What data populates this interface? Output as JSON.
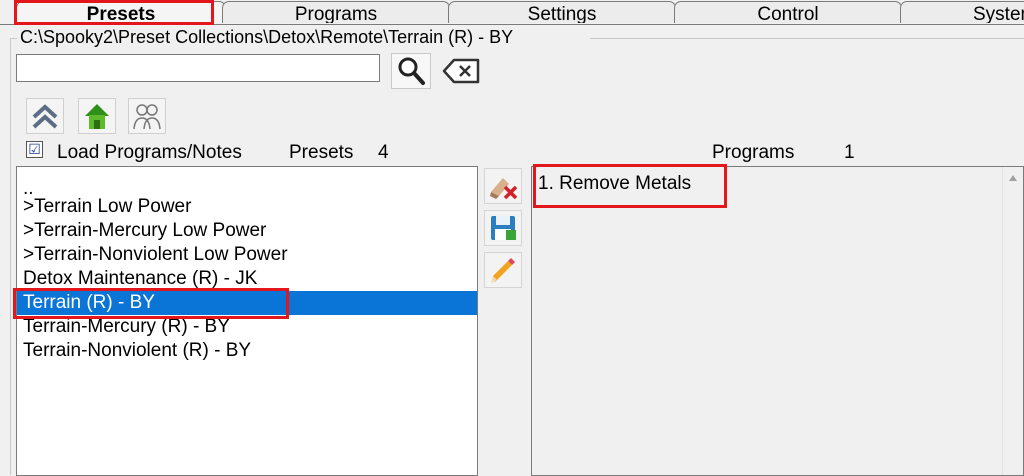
{
  "tabs": [
    {
      "label": "Presets",
      "active": true
    },
    {
      "label": "Programs",
      "active": false
    },
    {
      "label": "Settings",
      "active": false
    },
    {
      "label": "Control",
      "active": false
    },
    {
      "label": "System",
      "active": false
    }
  ],
  "path": "C:\\Spooky2\\Preset Collections\\Detox\\Remote\\Terrain (R) - BY",
  "search": {
    "value": "",
    "placeholder": ""
  },
  "icons": {
    "search": "magnifier-icon",
    "clear": "clear-x-icon",
    "up": "double-chevron-up-icon",
    "home": "home-icon",
    "users": "users-icon",
    "delete": "eraser-delete-icon",
    "save": "save-disk-icon",
    "edit": "pencil-icon"
  },
  "options": {
    "load_programs_label": "Load Programs/Notes",
    "load_programs_checked": true,
    "checkmark": "☑"
  },
  "presets": {
    "label": "Presets",
    "count": "4",
    "items": [
      {
        "label": "..",
        "selected": false
      },
      {
        "label": ">Terrain Low Power",
        "selected": false
      },
      {
        "label": ">Terrain-Mercury Low Power",
        "selected": false
      },
      {
        "label": ">Terrain-Nonviolent Low Power",
        "selected": false
      },
      {
        "label": "Detox Maintenance (R) - JK",
        "selected": false
      },
      {
        "label": "Terrain (R) - BY",
        "selected": true
      },
      {
        "label": "Terrain-Mercury (R) - BY",
        "selected": false
      },
      {
        "label": "Terrain-Nonviolent (R) - BY",
        "selected": false
      }
    ]
  },
  "programs": {
    "label": "Programs",
    "count": "1",
    "items": [
      {
        "label": "1. Remove Metals"
      }
    ]
  },
  "colors": {
    "highlight": "#e3161b",
    "selection": "#0a74d7"
  }
}
